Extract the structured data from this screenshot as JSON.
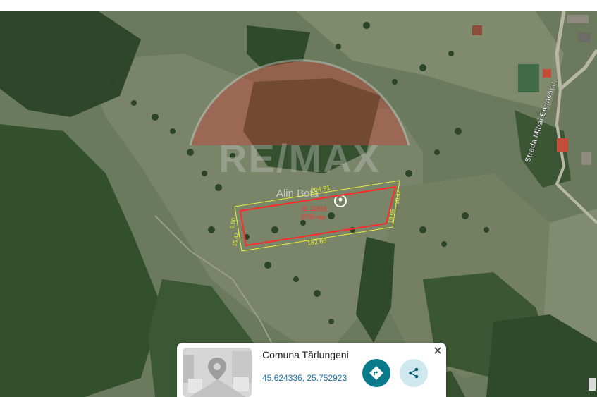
{
  "map": {
    "watermark_text": "RE/MAX",
    "watermark_name": "Alin Bota",
    "street_label": "Strada Mihai Eminescu",
    "parcel": {
      "lot_label": "IE 11816",
      "area_label": "3700 mp",
      "dim_top": "204.91",
      "dim_bottom": "182.66",
      "dim_left_upper": "9.50",
      "dim_left_lower": "16.42",
      "dim_right_upper": "20.47",
      "dim_right_lower": "19.05"
    },
    "colors": {
      "parcel_outline": "#ff2a2a",
      "dimension_lines": "#e8f23a",
      "watermark": "#c8433a"
    }
  },
  "card": {
    "title": "Comuna Tărlungeni",
    "coordinates": "45.624336, 25.752923",
    "directions_icon": "directions-icon",
    "share_icon": "share-icon",
    "close_icon": "close-icon"
  }
}
